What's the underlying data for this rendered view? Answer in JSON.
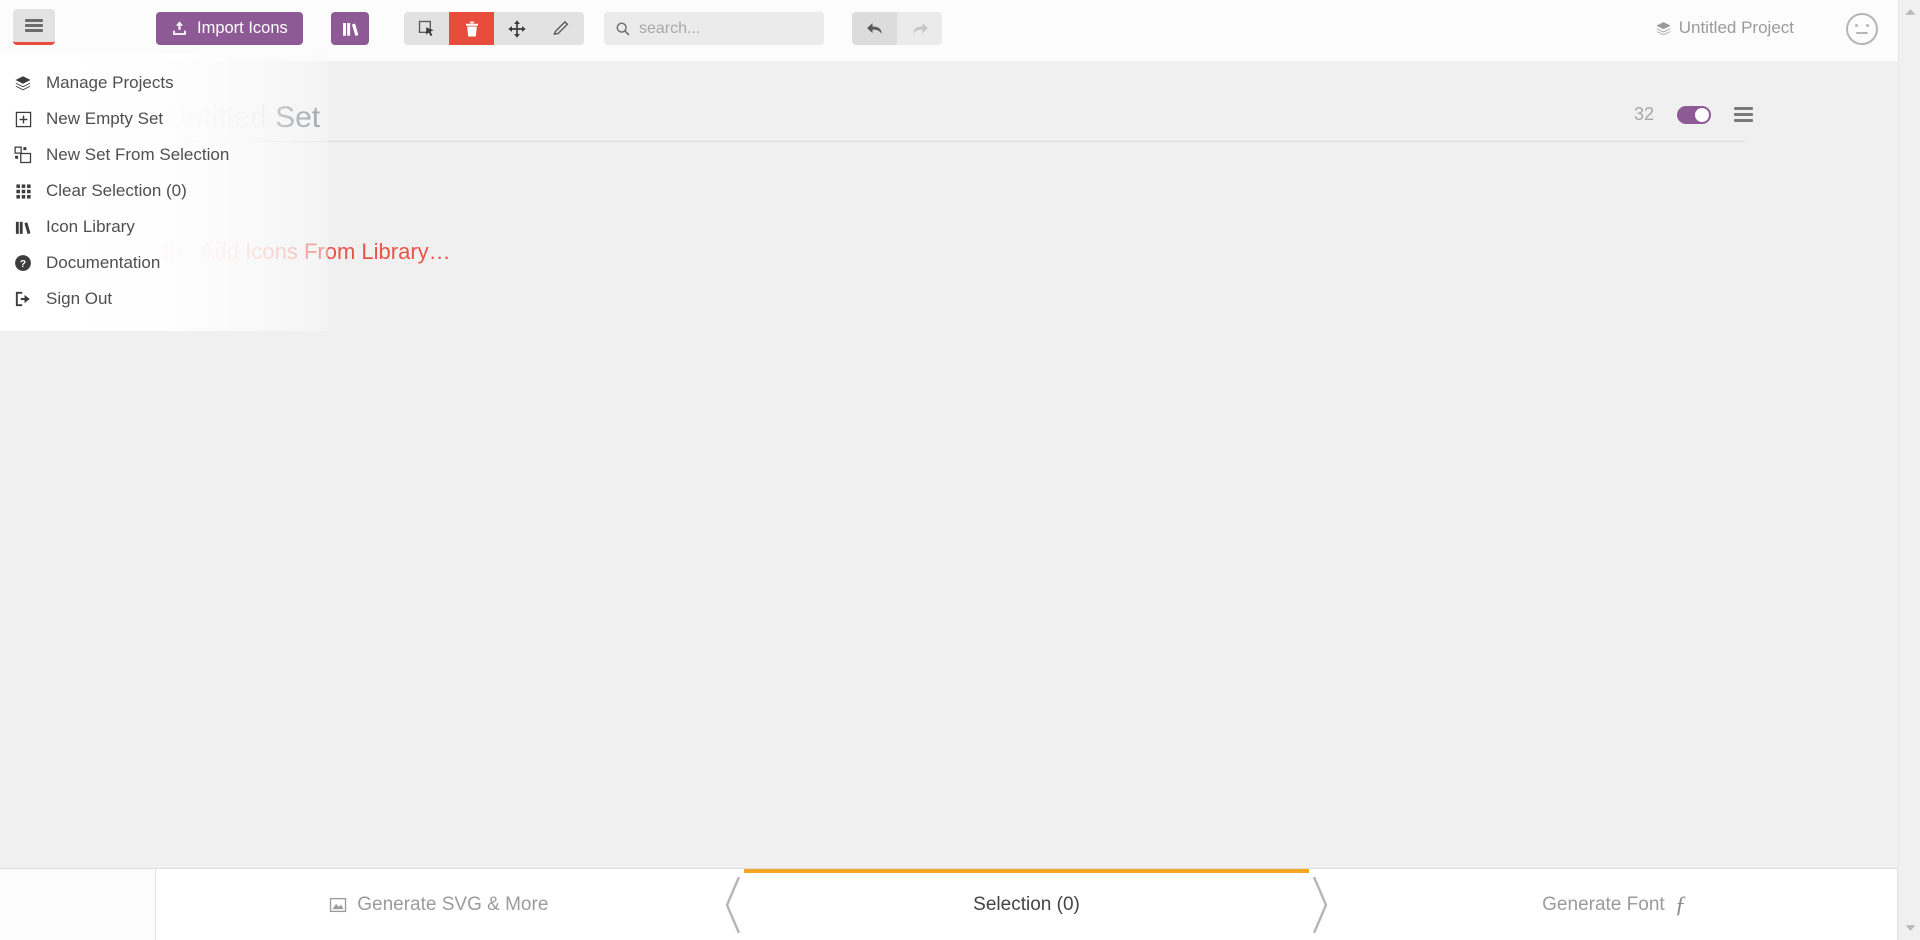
{
  "toolbar": {
    "menu_button_icon": "hamburger-icon",
    "import_label": "Import Icons",
    "import_icon": "upload-icon",
    "library_button_icon": "books-icon",
    "tools": [
      {
        "name": "select-tool",
        "icon": "cursor-select-icon",
        "active": false
      },
      {
        "name": "delete-tool",
        "icon": "trash-icon",
        "active": true
      },
      {
        "name": "move-tool",
        "icon": "move-arrows-icon",
        "active": false
      },
      {
        "name": "edit-tool",
        "icon": "pencil-icon",
        "active": false
      }
    ],
    "search_placeholder": "search...",
    "search_value": "",
    "search_icon": "search-icon",
    "undo_icon": "undo-arrow-icon",
    "redo_icon": "redo-arrow-icon",
    "project_name": "Untitled Project",
    "project_icon": "layers-icon",
    "avatar_icon": "neutral-face-avatar"
  },
  "dropdown": {
    "items": [
      {
        "label": "Manage Projects",
        "icon": "layers-icon"
      },
      {
        "label": "New Empty Set",
        "icon": "plus-square-icon"
      },
      {
        "label": "New Set From Selection",
        "icon": "copy-blocks-icon"
      },
      {
        "label": "Clear Selection (0)",
        "icon": "grid-dots-icon"
      },
      {
        "label": "Icon Library",
        "icon": "books-icon"
      },
      {
        "label": "Documentation",
        "icon": "question-circle-icon"
      },
      {
        "label": "Sign Out",
        "icon": "sign-out-icon"
      }
    ]
  },
  "set": {
    "title_placeholder": "Untitled",
    "title_word": "Set",
    "count": "32",
    "toggle_on": true,
    "menu_icon": "hamburger-icon",
    "add_from_library": {
      "icon": "books-icon",
      "part1": "Add ",
      "part2": "Icons ",
      "part3": "From Library…"
    }
  },
  "bottom": {
    "tabs": [
      {
        "label": "Generate SVG & More",
        "icon": "image-icon",
        "active": false
      },
      {
        "label": "Selection (0)",
        "icon": "",
        "active": true
      },
      {
        "label": "Generate Font",
        "icon": "script-f-icon",
        "active": false
      }
    ]
  },
  "colors": {
    "accent_purple": "#8e5a96",
    "active_red": "#e74c3c",
    "tab_orange": "#f5a623",
    "library_red": "#e8544a",
    "background": "#f0f0f0"
  }
}
